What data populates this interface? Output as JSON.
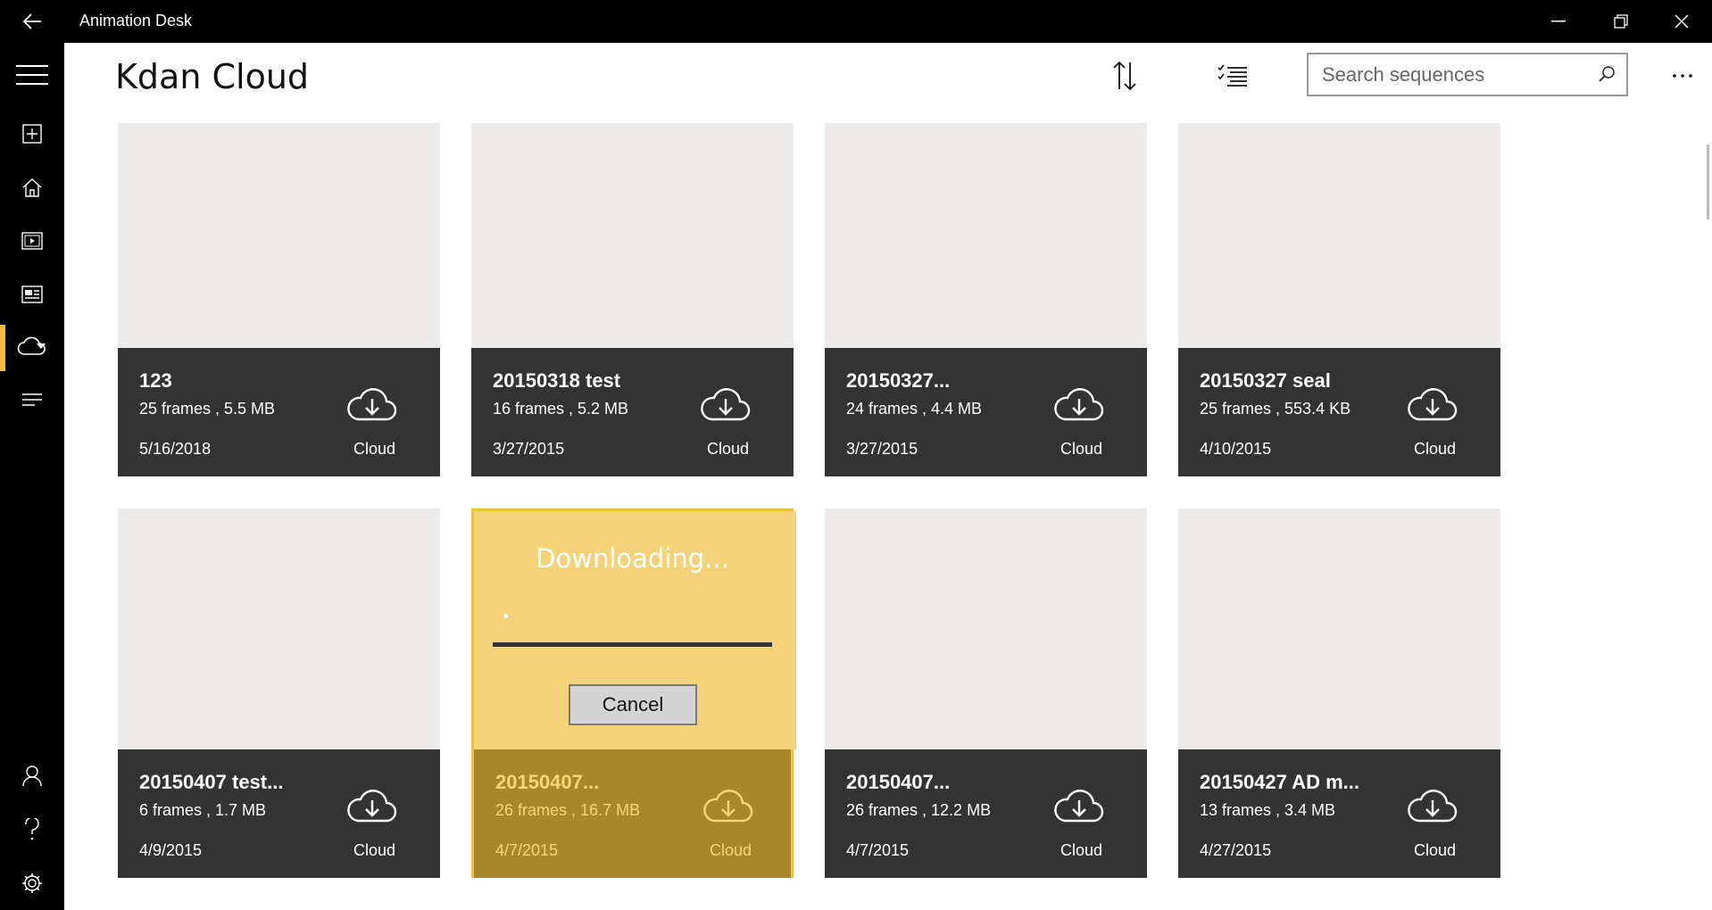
{
  "window": {
    "title": "Animation Desk"
  },
  "header": {
    "title": "Kdan Cloud",
    "search_placeholder": "Search sequences"
  },
  "icons": {
    "back": "back-arrow-icon",
    "minimize": "minimize-icon",
    "restore": "restore-icon",
    "close": "close-icon",
    "menu": "hamburger-icon",
    "new": "add-square-icon",
    "home": "home-icon",
    "videos": "video-icon",
    "gallery": "gallery-icon",
    "cloud": "cloud-icon",
    "list": "list-icon",
    "account": "person-icon",
    "help": "question-icon",
    "settings": "gear-icon",
    "sort": "sort-icon",
    "select": "checklist-icon",
    "search": "search-icon",
    "more": "more-icon",
    "download": "cloud-download-icon"
  },
  "colors": {
    "chrome": "#000000",
    "accent": "#f0c040",
    "card_info": "#333333",
    "thumb": "#edebe9",
    "downloading_thumb": "#f4d27a",
    "downloading_info": "#a8862a",
    "downloading_text": "#f7d774"
  },
  "cards": [
    {
      "name": "123",
      "meta": "25 frames ,  5.5 MB",
      "date": "5/16/2018",
      "location": "Cloud"
    },
    {
      "name": "20150318 test",
      "meta": "16 frames ,  5.2 MB",
      "date": "3/27/2015",
      "location": "Cloud"
    },
    {
      "name": "20150327...",
      "meta": "24 frames ,  4.4 MB",
      "date": "3/27/2015",
      "location": "Cloud"
    },
    {
      "name": "20150327 seal",
      "meta": "25 frames ,  553.4 KB",
      "date": "4/10/2015",
      "location": "Cloud"
    },
    {
      "name": "20150407 test...",
      "meta": "6 frames ,  1.7 MB",
      "date": "4/9/2015",
      "location": "Cloud"
    },
    {
      "name": "20150407...",
      "meta": "26 frames ,  16.7 MB",
      "date": "4/7/2015",
      "location": "Cloud"
    },
    {
      "name": "20150407...",
      "meta": "26 frames ,  12.2 MB",
      "date": "4/7/2015",
      "location": "Cloud"
    },
    {
      "name": "20150427 AD m...",
      "meta": "13 frames ,  3.4 MB",
      "date": "4/27/2015",
      "location": "Cloud"
    }
  ],
  "download": {
    "title": "Downloading...",
    "progress": 0,
    "cancel_label": "Cancel"
  }
}
